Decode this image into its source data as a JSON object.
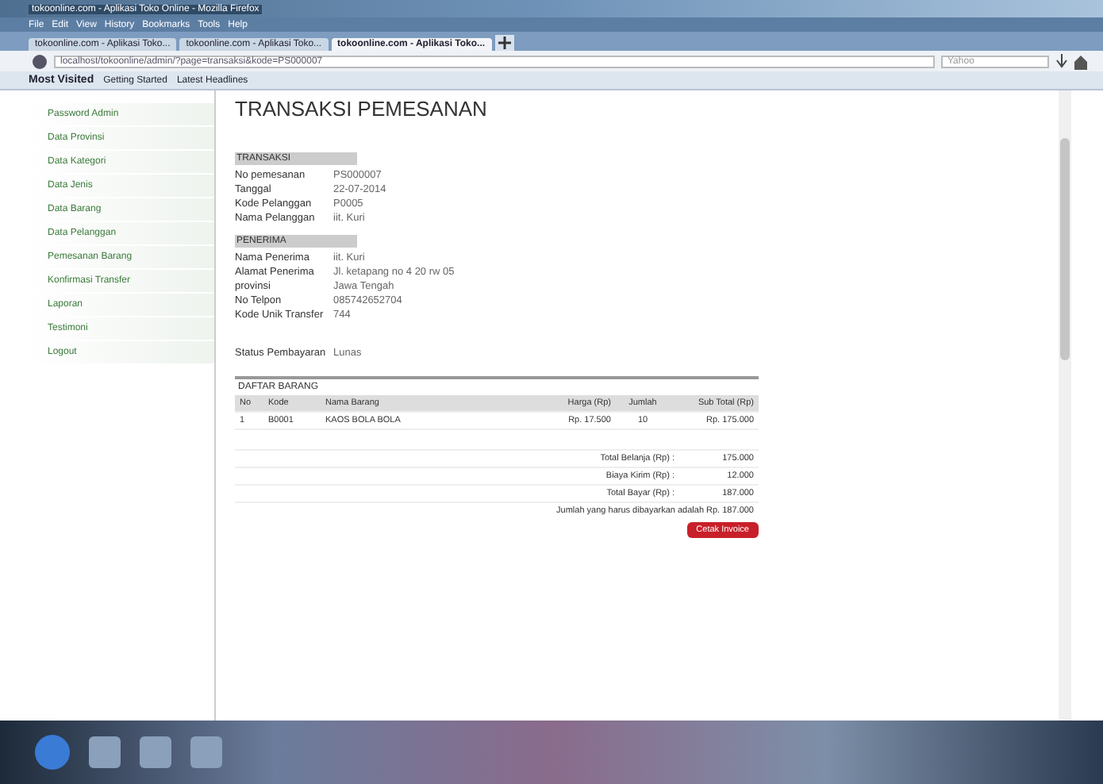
{
  "window": {
    "title": "tokoonline.com - Aplikasi Toko Online - Mozilla Firefox"
  },
  "menu": [
    "File",
    "Edit",
    "View",
    "History",
    "Bookmarks",
    "Tools",
    "Help"
  ],
  "tabs": [
    {
      "label": "tokoonline.com - Aplikasi Toko...",
      "selected": false
    },
    {
      "label": "tokoonline.com - Aplikasi Toko...",
      "selected": false
    },
    {
      "label": "tokoonline.com - Aplikasi Toko...",
      "selected": true
    }
  ],
  "address": {
    "value": "localhost/tokoonline/admin/?page=transaksi&kode=PS000007",
    "search_placeholder": "Yahoo"
  },
  "bookmarks": [
    "Most Visited",
    "Getting Started",
    "Latest Headlines"
  ],
  "sidebar": {
    "items": [
      "Password Admin",
      "Data Provinsi",
      "Data Kategori",
      "Data Jenis",
      "Data Barang",
      "Data Pelanggan",
      "Pemesanan Barang",
      "Konfirmasi Transfer",
      "Laporan",
      "Testimoni",
      "Logout"
    ]
  },
  "page": {
    "title": "TRANSAKSI PEMESANAN",
    "sections": [
      {
        "heading": "TRANSAKSI",
        "fields": [
          {
            "label": "No pemesanan",
            "value": "PS000007"
          },
          {
            "label": "Tanggal",
            "value": "22-07-2014"
          },
          {
            "label": "Kode Pelanggan",
            "value": "P0005"
          },
          {
            "label": "Nama Pelanggan",
            "value": "iit. Kuri"
          }
        ]
      },
      {
        "heading": "PENERIMA",
        "fields": [
          {
            "label": "Nama Penerima",
            "value": "iit. Kuri"
          },
          {
            "label": "Alamat Penerima",
            "value": "Jl. ketapang no 4 20 rw 05"
          },
          {
            "label": "provinsi",
            "value": "Jawa Tengah"
          },
          {
            "label": "No Telpon",
            "value": "085742652704"
          },
          {
            "label": "Kode Unik Transfer",
            "value": "744"
          }
        ]
      }
    ],
    "status": {
      "label": "Status Pembayaran",
      "value": "Lunas"
    },
    "table": {
      "title": "DAFTAR BARANG",
      "columns": [
        "No",
        "Kode",
        "Nama Barang",
        "Harga (Rp)",
        "Jumlah",
        "Sub Total (Rp)"
      ],
      "rows": [
        [
          "1",
          "B0001",
          "KAOS BOLA BOLA",
          "Rp. 17.500",
          "10",
          "Rp. 175.000"
        ]
      ]
    },
    "totals": [
      {
        "label": "Total Belanja (Rp) :",
        "value": "175.000"
      },
      {
        "label": "Biaya Kirim (Rp) :",
        "value": "12.000"
      },
      {
        "label": "Total Bayar (Rp) :",
        "value": "187.000"
      }
    ],
    "note": "Jumlah yang harus dibayarkan adalah Rp. 187.000",
    "button": "Cetak Invoice"
  }
}
